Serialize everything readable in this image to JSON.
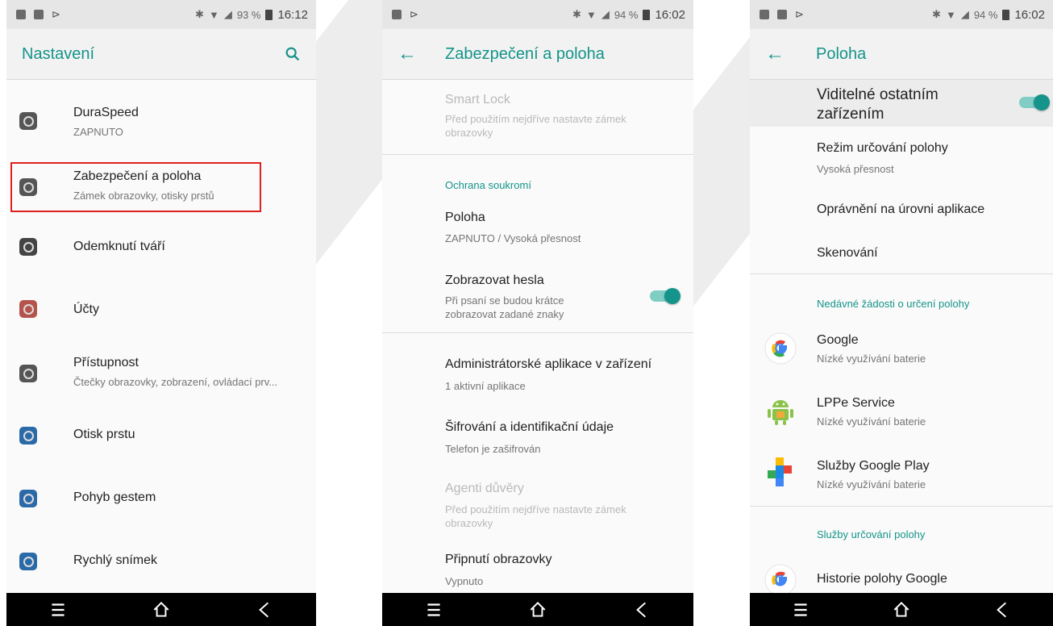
{
  "screen1": {
    "status": {
      "battery": "93 %",
      "time": "16:12"
    },
    "title": "Nastavení",
    "items": [
      {
        "label": "DuraSpeed",
        "sub": "ZAPNUTO",
        "icon": "duraspeed-icon",
        "color": "#555555"
      },
      {
        "label": "Zabezpečení a poloha",
        "sub": "Zámek obrazovky, otisky prstů",
        "icon": "lock-icon",
        "color": "#555555"
      },
      {
        "label": "Odemknutí tváří",
        "sub": "",
        "icon": "face-icon",
        "color": "#444444"
      },
      {
        "label": "Účty",
        "sub": "",
        "icon": "account-icon",
        "color": "#b5544c"
      },
      {
        "label": "Přístupnost",
        "sub": "Čtečky obrazovky, zobrazení, ovládací prv...",
        "icon": "accessibility-icon",
        "color": "#555555"
      },
      {
        "label": "Otisk prstu",
        "sub": "",
        "icon": "fingerprint-icon",
        "color": "#2b6aa8"
      },
      {
        "label": "Pohyb gestem",
        "sub": "",
        "icon": "gesture-icon",
        "color": "#2b6aa8"
      },
      {
        "label": "Rychlý snímek",
        "sub": "",
        "icon": "screenshot-icon",
        "color": "#2b6aa8"
      }
    ]
  },
  "screen2": {
    "status": {
      "battery": "94 %",
      "time": "16:02"
    },
    "title": "Zabezpečení a poloha",
    "smart_lock": {
      "label": "Smart Lock",
      "sub_1": "Před použitím nejdříve nastavte zámek",
      "sub_2": "obrazovky"
    },
    "section_privacy": "Ochrana soukromí",
    "location": {
      "label": "Poloha",
      "sub": "ZAPNUTO / Vysoká přesnost"
    },
    "show_passwords": {
      "label": "Zobrazovat hesla",
      "sub_1": "Při psaní se budou krátce",
      "sub_2": "zobrazovat zadané znaky",
      "on": true
    },
    "device_admin": {
      "label": "Administrátorské aplikace v zařízení",
      "sub": "1 aktivní aplikace"
    },
    "encryption": {
      "label": "Šifrování a identifikační údaje",
      "sub": "Telefon je zašifrován"
    },
    "trust_agents": {
      "label": "Agenti důvěry",
      "sub_1": "Před použitím nejdříve nastavte zámek",
      "sub_2": "obrazovky"
    },
    "screen_pinning": {
      "label": "Připnutí obrazovky",
      "sub": "Vypnuto"
    }
  },
  "screen3": {
    "status": {
      "battery": "94 %",
      "time": "16:02"
    },
    "title": "Poloha",
    "visible": {
      "label_1": "Viditelné ostatním",
      "label_2": "zařízením",
      "on": true
    },
    "mode": {
      "label": "Režim určování polohy",
      "sub": "Vysoká přesnost"
    },
    "app_permissions": "Oprávnění na úrovni aplikace",
    "scanning": "Skenování",
    "section_recent": "Nedávné žádosti o určení polohy",
    "recent": [
      {
        "label": "Google",
        "sub": "Nízké využívání baterie",
        "icon": "google-icon"
      },
      {
        "label": "LPPe Service",
        "sub": "Nízké využívání baterie",
        "icon": "android-icon"
      },
      {
        "label": "Služby Google Play",
        "sub": "Nízké využívání baterie",
        "icon": "play-services-icon"
      }
    ],
    "section_services": "Služby určování polohy",
    "history": {
      "label": "Historie polohy Google",
      "icon": "google-icon"
    }
  },
  "colors": {
    "accent": "#14948a",
    "highlight": "#e02020"
  }
}
